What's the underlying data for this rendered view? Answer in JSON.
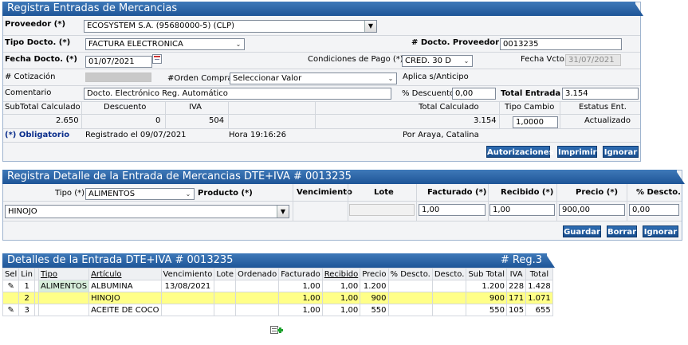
{
  "header": {
    "title": "Registra Entradas de Mercancias",
    "proveedor_label": "Proveedor (*)",
    "proveedor_value": "ECOSYSTEM S.A. (95680000-5) (CLP)",
    "tipo_docto_label": "Tipo Docto. (*)",
    "tipo_docto_value": "FACTURA ELECTRONICA",
    "num_docto_prov_label": "# Docto. Proveedor (*)",
    "num_docto_prov_value": "0013235",
    "fecha_docto_label": "Fecha Docto. (*)",
    "fecha_docto_value": "01/07/2021",
    "cond_pago_label": "Condiciones de Pago (*)",
    "cond_pago_value": "CRED. 30 D",
    "fecha_vcto_label": "Fecha Vcto.",
    "fecha_vcto_value": "31/07/2021",
    "cotizacion_label": "# Cotización",
    "orden_compra_label": "#Orden Compra",
    "orden_compra_value": "Seleccionar Valor",
    "aplica_anticipo_label": "Aplica s/Anticipo",
    "comentario_label": "Comentario",
    "comentario_value": "Docto. Electrónico Reg. Automático",
    "descuento_pct_label": "% Descuento",
    "descuento_pct_value": "0,00",
    "total_entrada_label": "Total Entrada (*)",
    "total_entrada_value": "3.154",
    "subtotal_label": "SubTotal Calculado",
    "subtotal_value": "2.650",
    "descuento_label": "Descuento",
    "descuento_value": "0",
    "iva_label": "IVA",
    "iva_value": "504",
    "total_calc_label": "Total Calculado",
    "total_calc_value": "3.154",
    "tipo_cambio_label": "Tipo Cambio",
    "tipo_cambio_value": "1,0000",
    "estatus_label": "Estatus Ent.",
    "estatus_value": "Actualizado",
    "obligatorio": "(*) Obligatorio",
    "registrado": "Registrado el 09/07/2021",
    "hora": "Hora 19:16:26",
    "por": "Por Araya, Catalina",
    "btn_autorizaciones": "Autorizaciones",
    "btn_imprimir": "Imprimir",
    "btn_ignorar": "Ignorar"
  },
  "detail": {
    "title": "Registra Detalle de la Entrada de Mercancias DTE+IVA # 0013235",
    "tipo_label": "Tipo (*)",
    "tipo_value": "ALIMENTOS",
    "producto_label": "Producto (*)",
    "producto_value": "HINOJO",
    "vencimiento_label": "Vencimiento",
    "lote_label": "Lote",
    "facturado_label": "Facturado (*)",
    "facturado_value": "1,00",
    "recibido_label": "Recibido (*)",
    "recibido_value": "1,00",
    "precio_label": "Precio (*)",
    "precio_value": "900,00",
    "descto_label": "% Descto.",
    "descto_value": "0,00",
    "btn_guardar": "Guardar",
    "btn_borrar": "Borrar",
    "btn_ignorar": "Ignorar"
  },
  "lines": {
    "title": "Detalles de la Entrada DTE+IVA # 0013235",
    "reg_count": "# Reg.3",
    "columns": [
      "Sel",
      "Lin",
      "",
      "Tipo",
      "Artículo",
      "Vencimiento",
      "Lote",
      "Ordenado",
      "Facturado",
      "Recibido",
      "Precio",
      "% Descto.",
      "Descto.",
      "Sub Total",
      "IVA",
      "Total"
    ],
    "rows": [
      {
        "lin": "1",
        "tipo": "ALIMENTOS",
        "articulo": "ALBUMINA",
        "vencimiento": "13/08/2021",
        "lote": "",
        "ordenado": "",
        "facturado": "1,00",
        "recibido": "1,00",
        "precio": "1.200",
        "pct": "",
        "descto": "",
        "subtotal": "1.200",
        "iva": "228",
        "total": "1.428"
      },
      {
        "lin": "2",
        "tipo": "",
        "articulo": "HINOJO",
        "vencimiento": "",
        "lote": "",
        "ordenado": "",
        "facturado": "1,00",
        "recibido": "1,00",
        "precio": "900",
        "pct": "",
        "descto": "",
        "subtotal": "900",
        "iva": "171",
        "total": "1.071"
      },
      {
        "lin": "3",
        "tipo": "",
        "articulo": "ACEITE DE COCO",
        "vencimiento": "",
        "lote": "",
        "ordenado": "",
        "facturado": "1,00",
        "recibido": "1,00",
        "precio": "550",
        "pct": "",
        "descto": "",
        "subtotal": "550",
        "iva": "105",
        "total": "655"
      }
    ]
  },
  "colors": {
    "bar": "#2a64a8",
    "highlight": "#ffff88",
    "button": "#1f5a9e"
  }
}
